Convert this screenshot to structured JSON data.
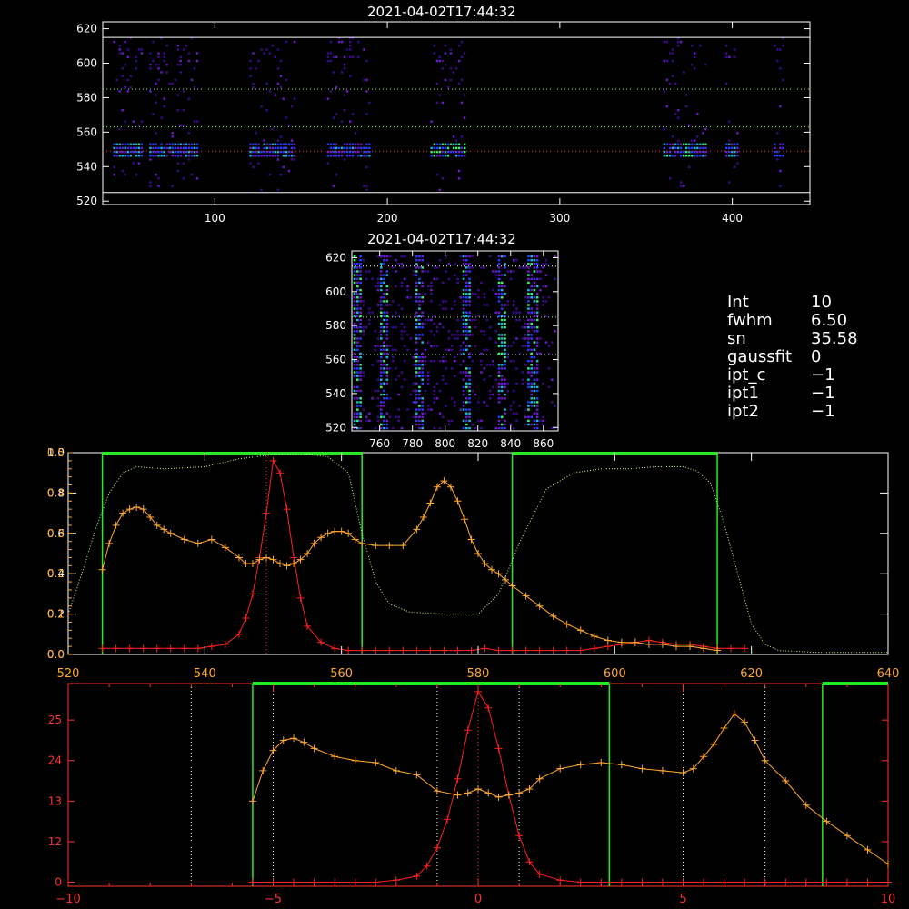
{
  "top_panel": {
    "title": "2021-04-02T17:44:32",
    "y_ticks": [
      520,
      540,
      560,
      580,
      600,
      620
    ],
    "x_ticks": [
      100,
      200,
      300,
      400
    ],
    "xlim": [
      35,
      445
    ],
    "ylim": [
      518,
      624
    ],
    "guides": {
      "white": [
        525,
        615
      ],
      "green_dotted": [
        563,
        585
      ],
      "red_dotted": 549
    }
  },
  "mid_panel": {
    "title": "2021-04-02T17:44:32",
    "y_ticks": [
      520,
      540,
      560,
      580,
      600,
      620
    ],
    "x_ticks": [
      760,
      780,
      800,
      820,
      840,
      860
    ],
    "xlim": [
      743,
      869
    ],
    "ylim": [
      518,
      624
    ],
    "guides": {
      "green_dotted": [
        563,
        585
      ],
      "white_dotted": 615
    }
  },
  "info": [
    {
      "key": "Int",
      "value": "10"
    },
    {
      "key": "fwhm",
      "value": "6.50"
    },
    {
      "key": "sn",
      "value": "35.58"
    },
    {
      "key": "gaussfit",
      "value": "0"
    },
    {
      "key": "ipt_c",
      "value": "−1"
    },
    {
      "key": "ipt1",
      "value": "−1"
    },
    {
      "key": "ipt2",
      "value": "−1"
    }
  ],
  "chart_data": [
    {
      "type": "line",
      "xlim": [
        520,
        640
      ],
      "ylim": [
        0,
        1.0
      ],
      "x_ticks": [
        520,
        540,
        560,
        580,
        600,
        620,
        640
      ],
      "y_ticks_left": [
        "0.0",
        "0.2",
        "0.4",
        "0.6",
        "0.8",
        "1.0"
      ],
      "y_ticks_overlay": [
        "0.0",
        "0.1",
        "0.2",
        "0.3",
        "0.4",
        "0.5"
      ],
      "windows": [
        [
          525,
          563
        ],
        [
          585,
          615
        ]
      ],
      "peak_marker": 549,
      "series": [
        {
          "role": "red_profile",
          "color": "#ff2020",
          "x": [
            525,
            527,
            529,
            531,
            533,
            535,
            537,
            539,
            541,
            543,
            545,
            546,
            547,
            548,
            549,
            550,
            551,
            552,
            553,
            554,
            555,
            557,
            559,
            561,
            563,
            565,
            567,
            569,
            571,
            573,
            575,
            577,
            579,
            581,
            583,
            585,
            587,
            589,
            591,
            593,
            595,
            597,
            599,
            601,
            603,
            605,
            607,
            609,
            611,
            613,
            615,
            617,
            619
          ],
          "y": [
            0.03,
            0.03,
            0.03,
            0.03,
            0.03,
            0.03,
            0.03,
            0.03,
            0.04,
            0.05,
            0.1,
            0.18,
            0.3,
            0.48,
            0.7,
            0.96,
            0.9,
            0.72,
            0.48,
            0.28,
            0.14,
            0.06,
            0.03,
            0.02,
            0.02,
            0.02,
            0.02,
            0.02,
            0.02,
            0.02,
            0.02,
            0.02,
            0.02,
            0.03,
            0.02,
            0.02,
            0.02,
            0.02,
            0.02,
            0.02,
            0.02,
            0.03,
            0.04,
            0.05,
            0.06,
            0.07,
            0.06,
            0.05,
            0.05,
            0.04,
            0.03,
            0.03,
            0.03
          ]
        },
        {
          "role": "orange_profile",
          "color": "#ffa830",
          "x": [
            525,
            526,
            527,
            528,
            529,
            530,
            531,
            532,
            533,
            534,
            535,
            537,
            539,
            541,
            543,
            545,
            546,
            547,
            548,
            549,
            550,
            551,
            552,
            553,
            554,
            555,
            556,
            557,
            558,
            559,
            560,
            561,
            562,
            563,
            565,
            567,
            569,
            571,
            572,
            573,
            574,
            575,
            576,
            577,
            578,
            579,
            580,
            581,
            582,
            583,
            584,
            585,
            587,
            589,
            591,
            593,
            595,
            597,
            599,
            601,
            603,
            605,
            607,
            609,
            611,
            613,
            615
          ],
          "y": [
            0.42,
            0.55,
            0.64,
            0.7,
            0.72,
            0.73,
            0.72,
            0.68,
            0.64,
            0.62,
            0.6,
            0.57,
            0.55,
            0.57,
            0.53,
            0.48,
            0.45,
            0.45,
            0.47,
            0.48,
            0.47,
            0.45,
            0.44,
            0.45,
            0.47,
            0.5,
            0.55,
            0.58,
            0.6,
            0.61,
            0.61,
            0.6,
            0.57,
            0.55,
            0.54,
            0.54,
            0.54,
            0.62,
            0.68,
            0.75,
            0.83,
            0.86,
            0.83,
            0.76,
            0.67,
            0.57,
            0.5,
            0.45,
            0.42,
            0.4,
            0.37,
            0.34,
            0.29,
            0.24,
            0.19,
            0.15,
            0.12,
            0.09,
            0.07,
            0.06,
            0.06,
            0.05,
            0.05,
            0.04,
            0.04,
            0.03,
            0.02
          ]
        },
        {
          "role": "filter_curve",
          "color": "#c8ff90",
          "x": [
            520,
            522,
            524,
            526,
            528,
            530,
            534,
            540,
            545,
            550,
            555,
            558,
            561,
            563,
            565,
            567,
            570,
            575,
            580,
            583,
            586,
            590,
            594,
            598,
            602,
            606,
            610,
            612,
            614,
            616,
            618,
            620,
            622,
            624,
            630,
            640
          ],
          "y": [
            0.2,
            0.4,
            0.62,
            0.8,
            0.9,
            0.93,
            0.92,
            0.93,
            0.97,
            0.99,
            0.99,
            0.98,
            0.9,
            0.6,
            0.36,
            0.25,
            0.21,
            0.2,
            0.2,
            0.3,
            0.55,
            0.82,
            0.9,
            0.92,
            0.92,
            0.93,
            0.93,
            0.91,
            0.85,
            0.65,
            0.4,
            0.15,
            0.05,
            0.02,
            0.01,
            0.01
          ]
        }
      ]
    },
    {
      "type": "line",
      "xlim": [
        -10,
        10
      ],
      "ylim": [
        0,
        1.0
      ],
      "x_ticks": [
        -10,
        -5,
        0,
        5,
        10
      ],
      "y_ticks": [
        "0",
        "12",
        "13",
        "24",
        "25"
      ],
      "windows": [
        [
          -5.5,
          3.2
        ],
        [
          8.4,
          10
        ]
      ],
      "dotted_white": [
        -7,
        -5,
        -1,
        1,
        5,
        7
      ],
      "dotted_red": 0,
      "series": [
        {
          "role": "red_profile",
          "color": "#ff2020",
          "x": [
            -5.5,
            -5,
            -4.5,
            -4,
            -3.5,
            -3,
            -2.5,
            -2,
            -1.5,
            -1.25,
            -1,
            -0.75,
            -0.5,
            -0.25,
            0,
            0.25,
            0.5,
            0.75,
            1,
            1.25,
            1.5,
            2,
            2.5,
            3,
            3.5,
            4,
            4.5,
            5,
            5.5,
            6,
            6.5,
            7,
            7.5,
            8,
            8.5,
            9,
            9.5,
            10
          ],
          "y": [
            0.02,
            0.02,
            0.02,
            0.02,
            0.02,
            0.02,
            0.02,
            0.03,
            0.05,
            0.1,
            0.19,
            0.33,
            0.53,
            0.77,
            0.96,
            0.88,
            0.68,
            0.45,
            0.25,
            0.12,
            0.06,
            0.03,
            0.02,
            0.02,
            0.02,
            0.02,
            0.02,
            0.02,
            0.02,
            0.02,
            0.02,
            0.02,
            0.02,
            0.02,
            0.02,
            0.02,
            0.02,
            0.02
          ]
        },
        {
          "role": "orange_profile",
          "color": "#ffa830",
          "x": [
            -5.5,
            -5.25,
            -5,
            -4.75,
            -4.5,
            -4.25,
            -4,
            -3.5,
            -3,
            -2.5,
            -2,
            -1.5,
            -1,
            -0.5,
            -0.25,
            0,
            0.25,
            0.5,
            0.75,
            1,
            1.25,
            1.5,
            2,
            2.5,
            3,
            3.5,
            4,
            4.5,
            5,
            5.25,
            5.5,
            5.75,
            6,
            6.25,
            6.5,
            6.75,
            7,
            7.5,
            8,
            8.5,
            9,
            9.5,
            10
          ],
          "y": [
            0.42,
            0.57,
            0.67,
            0.72,
            0.73,
            0.71,
            0.68,
            0.64,
            0.62,
            0.61,
            0.57,
            0.55,
            0.47,
            0.45,
            0.46,
            0.48,
            0.46,
            0.44,
            0.45,
            0.46,
            0.48,
            0.53,
            0.58,
            0.6,
            0.61,
            0.6,
            0.58,
            0.57,
            0.56,
            0.58,
            0.64,
            0.7,
            0.78,
            0.85,
            0.81,
            0.72,
            0.62,
            0.52,
            0.4,
            0.32,
            0.25,
            0.18,
            0.11
          ]
        }
      ]
    }
  ]
}
